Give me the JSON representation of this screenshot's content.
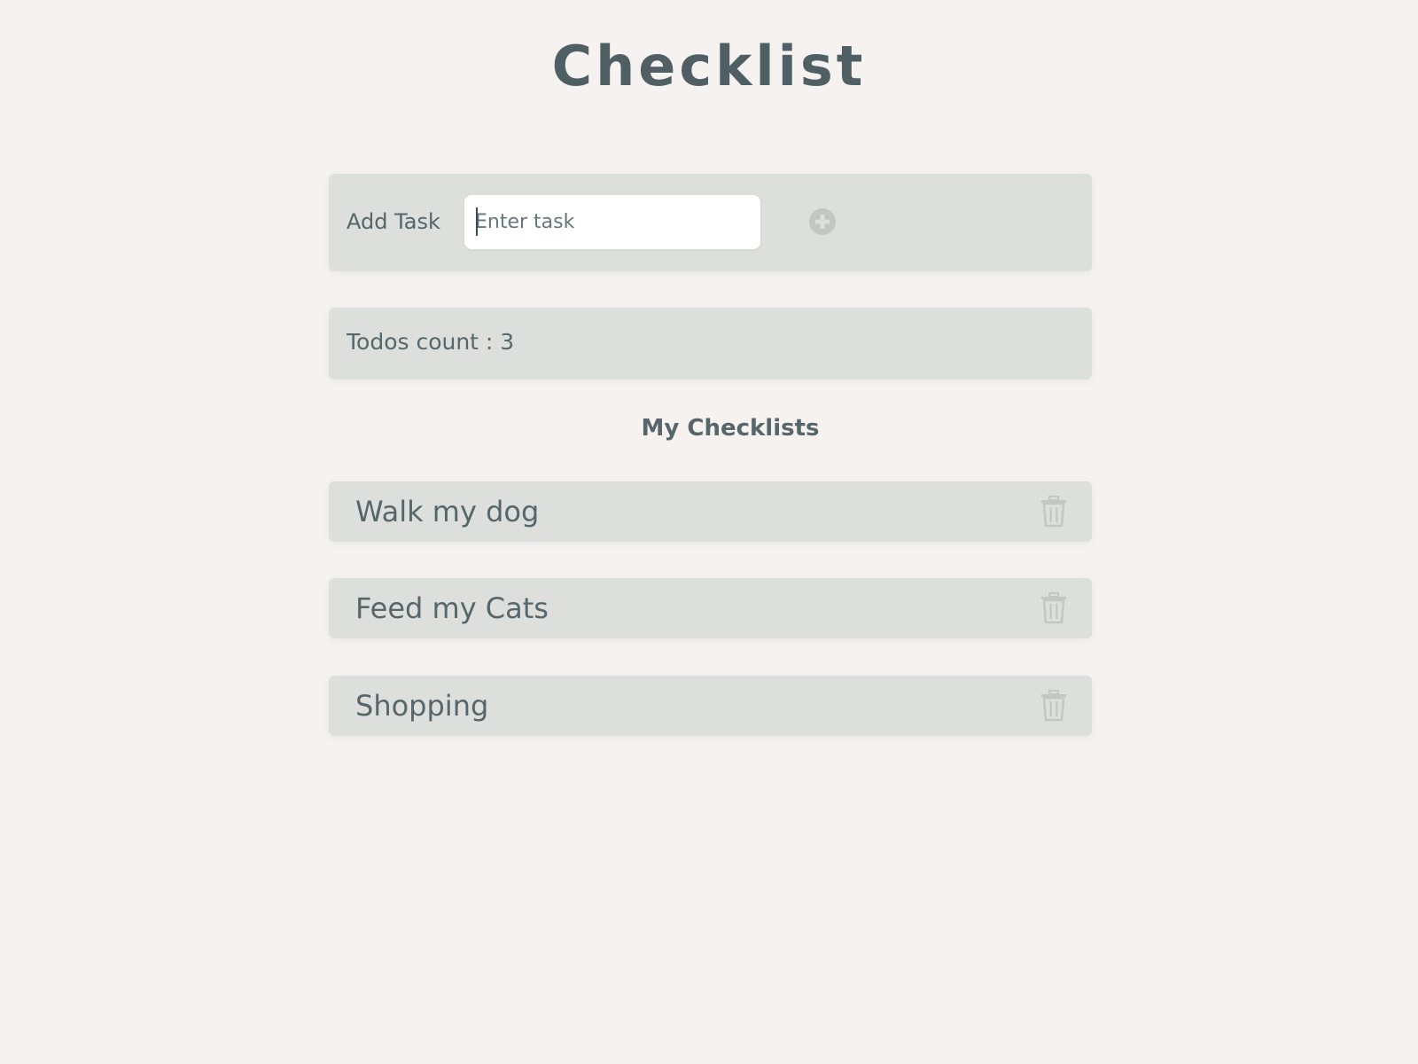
{
  "title": "Checklist",
  "add_task": {
    "label": "Add Task",
    "input_placeholder": "Enter task",
    "input_value": "",
    "add_icon": "plus-circle-icon"
  },
  "todo_count": {
    "text": "Todos count : 3"
  },
  "section_title": "My Checklists",
  "todos": [
    {
      "label": "Walk my dog",
      "delete_icon": "trash-icon"
    },
    {
      "label": "Feed my Cats",
      "delete_icon": "trash-icon"
    },
    {
      "label": "Shopping",
      "delete_icon": "trash-icon"
    }
  ],
  "colors": {
    "background": "#f5f2ef",
    "panel": "#dcdfdb",
    "text": "#56666b",
    "icon": "#c3c7c4"
  }
}
